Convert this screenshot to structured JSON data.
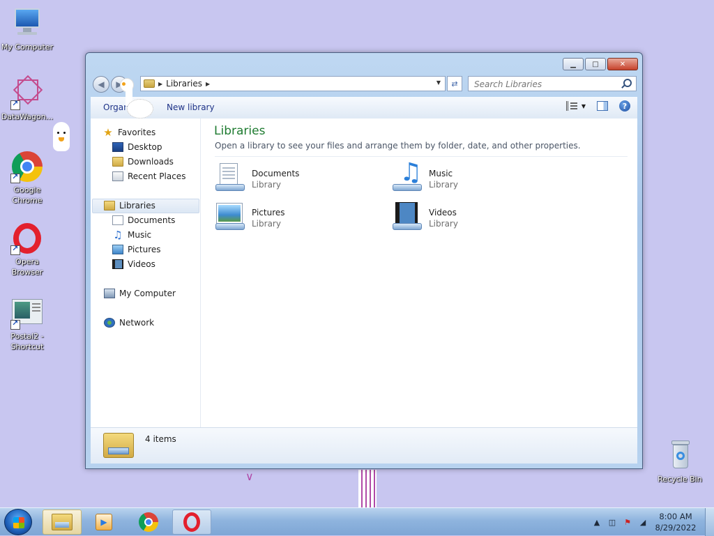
{
  "desktop": {
    "icons": [
      {
        "label": "My Computer"
      },
      {
        "label": "DataWagon..."
      },
      {
        "label": "Google Chrome"
      },
      {
        "label": "Opera Browser"
      },
      {
        "label": "Postal2 - Shortcut"
      },
      {
        "label": "Recycle Bin"
      }
    ]
  },
  "window": {
    "controls": {
      "minimize": "▁",
      "maximize": "□",
      "close": "✕"
    },
    "address": {
      "path": "Libraries"
    },
    "search": {
      "placeholder": "Search Libraries"
    },
    "toolbar": {
      "organize": "Organize ▾",
      "new_library": "New library",
      "help": "?"
    },
    "nav": {
      "favorites": "Favorites",
      "desktop": "Desktop",
      "downloads": "Downloads",
      "recent": "Recent Places",
      "libraries": "Libraries",
      "documents": "Documents",
      "music": "Music",
      "pictures": "Pictures",
      "videos": "Videos",
      "computer": "My Computer",
      "network": "Network"
    },
    "main": {
      "title": "Libraries",
      "subtitle": "Open a library to see your files and arrange them by folder, date, and other properties.",
      "libraries": [
        {
          "name": "Documents",
          "kind": "Library"
        },
        {
          "name": "Music",
          "kind": "Library"
        },
        {
          "name": "Pictures",
          "kind": "Library"
        },
        {
          "name": "Videos",
          "kind": "Library"
        }
      ]
    },
    "details": {
      "count": "4 items"
    }
  },
  "taskbar": {
    "clock": {
      "time": "8:00 AM",
      "date": "8/29/2022"
    }
  },
  "colors": {
    "desktop_bg": "#c8c6f0",
    "title_green": "#1e7b30",
    "link_blue": "#1e3287"
  }
}
